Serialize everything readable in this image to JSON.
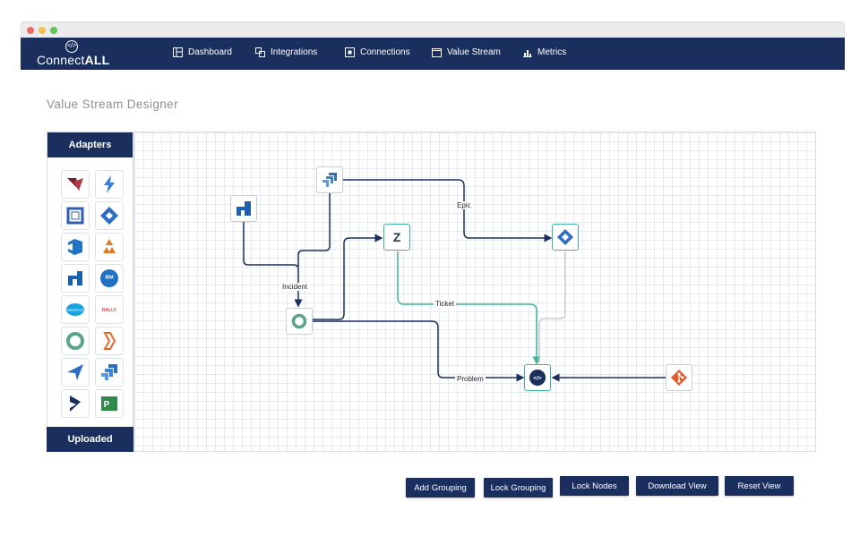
{
  "app": {
    "brand_prefix": "Connect",
    "brand_suffix": "ALL",
    "logo_mark": "</>"
  },
  "nav": {
    "items": [
      {
        "label": "Dashboard",
        "icon": "dashboard-icon"
      },
      {
        "label": "Integrations",
        "icon": "integrations-icon"
      },
      {
        "label": "Connections",
        "icon": "connections-icon"
      },
      {
        "label": "Value Stream",
        "icon": "value-stream-icon"
      },
      {
        "label": "Metrics",
        "icon": "metrics-icon"
      }
    ]
  },
  "page": {
    "title": "Value Stream Designer"
  },
  "sidebar": {
    "header": "Adapters",
    "footer": "Uploaded",
    "adapters": [
      {
        "icon": "v-logo-icon"
      },
      {
        "icon": "lightning-icon"
      },
      {
        "icon": "square-frame-icon"
      },
      {
        "icon": "jira-diamond-icon"
      },
      {
        "icon": "azure-devops-icon"
      },
      {
        "icon": "tri-flower-icon"
      },
      {
        "icon": "arrow-corner-icon"
      },
      {
        "icon": "ibm-icon",
        "text": "IBM"
      },
      {
        "icon": "salesforce-icon",
        "text": "salesforce"
      },
      {
        "icon": "rally-icon",
        "text": "RALLY"
      },
      {
        "icon": "ring-icon"
      },
      {
        "icon": "bolt-orange-icon"
      },
      {
        "icon": "paper-plane-icon"
      },
      {
        "icon": "jira-chevrons-icon"
      },
      {
        "icon": "dynamics-icon"
      },
      {
        "icon": "project-icon",
        "text": "P"
      }
    ]
  },
  "canvas": {
    "labels": {
      "epic": "Epic",
      "incident": "Incident",
      "ticket": "Ticket",
      "problem": "Problem"
    },
    "nodes": [
      {
        "id": "arrow-node",
        "icon": "arrow-corner-icon"
      },
      {
        "id": "jira-software-node",
        "icon": "jira-chevrons-icon"
      },
      {
        "id": "zendesk-node",
        "icon": "zendesk-icon",
        "text": "Z"
      },
      {
        "id": "jira-diamond-node",
        "icon": "jira-diamond-icon"
      },
      {
        "id": "ring-node",
        "icon": "ring-icon"
      },
      {
        "id": "connectall-node",
        "icon": "connectall-icon",
        "text": "</>"
      },
      {
        "id": "git-node",
        "icon": "git-icon"
      }
    ],
    "colors": {
      "primary_edge": "#1b2f5e",
      "teal_edge": "#3db59a",
      "gray_edge": "#c6cad1"
    }
  },
  "actions": {
    "add_grouping": "Add Grouping",
    "lock_grouping": "Lock Grouping",
    "lock_nodes": "Lock Nodes",
    "download_view": "Download View",
    "reset_view": "Reset View"
  },
  "colors": {
    "navy": "#1b2f5e",
    "teal": "#3db59a",
    "blue": "#2c6fc2",
    "orange": "#e05a2b"
  }
}
